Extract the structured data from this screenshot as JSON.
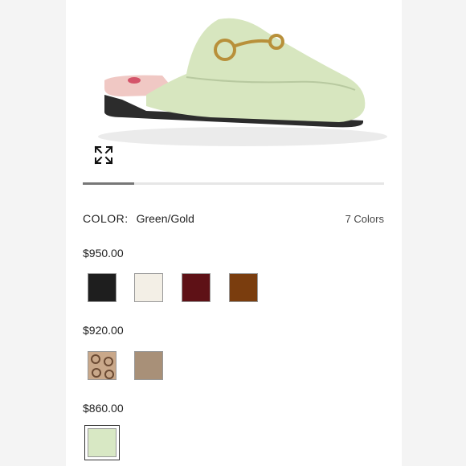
{
  "product": {
    "image_name": "green-gold-horsebit-slipper"
  },
  "carousel": {
    "position": 0.17
  },
  "color_selector": {
    "label": "COLOR:",
    "selected_value": "Green/Gold",
    "count_text": "7 Colors"
  },
  "price_groups": [
    {
      "price": "$950.00",
      "swatches": [
        {
          "name": "black",
          "color": "#1e1e1e"
        },
        {
          "name": "white",
          "color": "#f3efe6"
        },
        {
          "name": "burgundy",
          "color": "#5e1116"
        },
        {
          "name": "brown",
          "color": "#7a3d0e"
        }
      ]
    },
    {
      "price": "$920.00",
      "swatches": [
        {
          "name": "gg-canvas",
          "color": "#c9a88a"
        },
        {
          "name": "taupe",
          "color": "#a89078"
        }
      ]
    },
    {
      "price": "$860.00",
      "swatches": [
        {
          "name": "green",
          "color": "#d8e8c4",
          "selected": true
        }
      ]
    }
  ],
  "icons": {
    "expand": "expand-icon"
  }
}
